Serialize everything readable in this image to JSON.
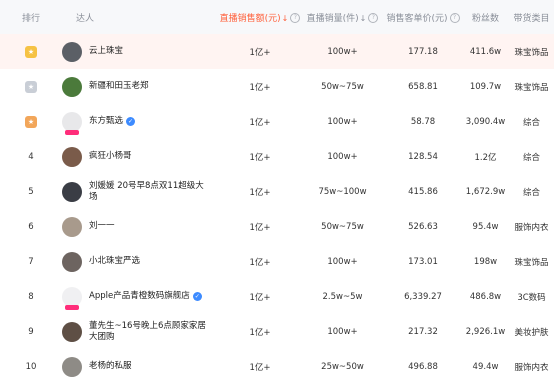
{
  "headers": {
    "rank": "排行",
    "name": "达人",
    "live_sales": "直播销售额(元)",
    "live_volume": "直播销量(件)",
    "avg_price": "销售客单价(元)",
    "fans": "粉丝数",
    "category": "带货类目",
    "sort_glyph": "↓",
    "help_glyph": "?"
  },
  "colors": {
    "accent": "#ff5f3a",
    "highlight_row": "#fff4f2",
    "header_bg": "#f7f8fa",
    "verified": "#3d8bff"
  },
  "rows": [
    {
      "rank": "1",
      "medal": "gold",
      "name": "云上珠宝",
      "verified": false,
      "live": "1亿+",
      "vol": "100w+",
      "price": "177.18",
      "fans": "411.6w",
      "cat": "珠宝饰品",
      "avatar": "#5b5f66",
      "highlight": true
    },
    {
      "rank": "2",
      "medal": "silver",
      "name": "新疆和田玉老郑",
      "verified": false,
      "live": "1亿+",
      "vol": "50w~75w",
      "price": "658.81",
      "fans": "109.7w",
      "cat": "珠宝饰品",
      "avatar": "#4b7a3b",
      "highlight": false
    },
    {
      "rank": "3",
      "medal": "bronze",
      "name": "东方甄选",
      "verified": true,
      "live": "1亿+",
      "vol": "100w+",
      "price": "58.78",
      "fans": "3,090.4w",
      "cat": "综合",
      "avatar": "#e8e8ea",
      "highlight": false,
      "tag": true
    },
    {
      "rank": "4",
      "medal": "",
      "name": "疯狂小杨哥",
      "verified": false,
      "live": "1亿+",
      "vol": "100w+",
      "price": "128.54",
      "fans": "1.2亿",
      "cat": "综合",
      "avatar": "#7a5b4a",
      "highlight": false
    },
    {
      "rank": "5",
      "medal": "",
      "name": "刘媛媛 20号早8点双11超级大场",
      "verified": false,
      "live": "1亿+",
      "vol": "75w~100w",
      "price": "415.86",
      "fans": "1,672.9w",
      "cat": "综合",
      "avatar": "#3a3d45",
      "highlight": false
    },
    {
      "rank": "6",
      "medal": "",
      "name": "刘一一",
      "verified": false,
      "live": "1亿+",
      "vol": "50w~75w",
      "price": "526.63",
      "fans": "95.4w",
      "cat": "服饰内衣",
      "avatar": "#a89a8c",
      "highlight": false
    },
    {
      "rank": "7",
      "medal": "",
      "name": "小北珠宝严选",
      "verified": false,
      "live": "1亿+",
      "vol": "100w+",
      "price": "173.01",
      "fans": "198w",
      "cat": "珠宝饰品",
      "avatar": "#6d6460",
      "highlight": false
    },
    {
      "rank": "8",
      "medal": "",
      "name": "Apple产品青橙数码旗舰店",
      "verified": true,
      "live": "1亿+",
      "vol": "2.5w~5w",
      "price": "6,339.27",
      "fans": "486.8w",
      "cat": "3C数码",
      "avatar": "#f0f0f2",
      "highlight": false,
      "tag": true
    },
    {
      "rank": "9",
      "medal": "",
      "name": "董先生~16号晚上6点顾家家居大团购",
      "verified": false,
      "live": "1亿+",
      "vol": "100w+",
      "price": "217.32",
      "fans": "2,926.1w",
      "cat": "美妆护肤",
      "avatar": "#5e4f45",
      "highlight": false
    },
    {
      "rank": "10",
      "medal": "",
      "name": "老杨的私服",
      "verified": false,
      "live": "1亿+",
      "vol": "25w~50w",
      "price": "496.88",
      "fans": "49.4w",
      "cat": "服饰内衣",
      "avatar": "#8e8b86",
      "highlight": false
    }
  ]
}
